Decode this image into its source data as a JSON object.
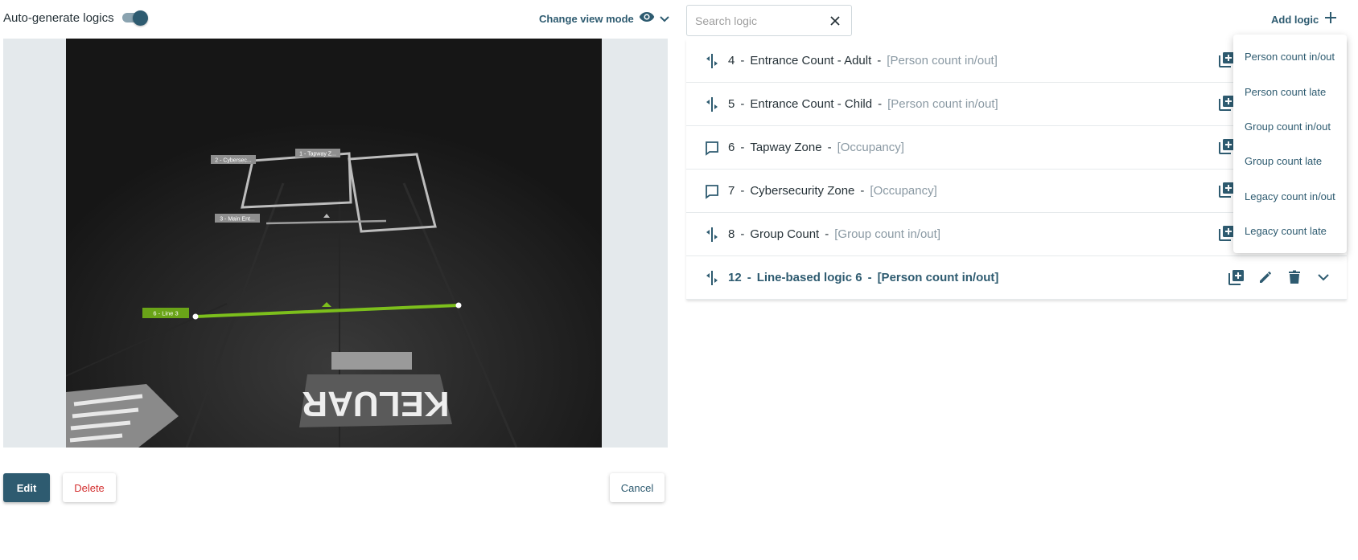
{
  "auto_generate": {
    "label": "Auto-generate logics",
    "enabled": true
  },
  "view_mode": {
    "label": "Change view mode"
  },
  "camera": {
    "overlays": [
      {
        "tag": "1 - Tapway Z..."
      },
      {
        "tag": "2 - Cybersec..."
      },
      {
        "tag": "3 - Main Ent..."
      },
      {
        "tag": "6 - Line 3"
      }
    ],
    "sign_text": "KELUAR",
    "active_color": "#7cbf1c"
  },
  "actions": {
    "edit": "Edit",
    "delete": "Delete",
    "cancel": "Cancel"
  },
  "search": {
    "placeholder": "Search logic",
    "value": ""
  },
  "add_logic": {
    "label": "Add logic",
    "menu": [
      "Person count in/out",
      "Person count late",
      "Group count in/out",
      "Group count late",
      "Legacy count in/out",
      "Legacy count late"
    ]
  },
  "logics": [
    {
      "id": "4",
      "name": "Entrance Count - Adult",
      "type": "[Person count in/out]",
      "icon": "line-logic-icon"
    },
    {
      "id": "5",
      "name": "Entrance Count - Child",
      "type": "[Person count in/out]",
      "icon": "line-logic-icon"
    },
    {
      "id": "6",
      "name": "Tapway Zone",
      "type": "[Occupancy]",
      "icon": "zone-logic-icon"
    },
    {
      "id": "7",
      "name": "Cybersecurity Zone",
      "type": "[Occupancy]",
      "icon": "zone-logic-icon"
    },
    {
      "id": "8",
      "name": "Group Count",
      "type": "[Group count in/out]",
      "icon": "line-logic-icon"
    },
    {
      "id": "12",
      "name": "Line-based logic 6",
      "type": "[Person count in/out]",
      "icon": "line-logic-icon",
      "active": true
    }
  ],
  "colors": {
    "primary": "#2e5b70",
    "danger": "#d32f2f",
    "muted": "#8a99a3"
  }
}
